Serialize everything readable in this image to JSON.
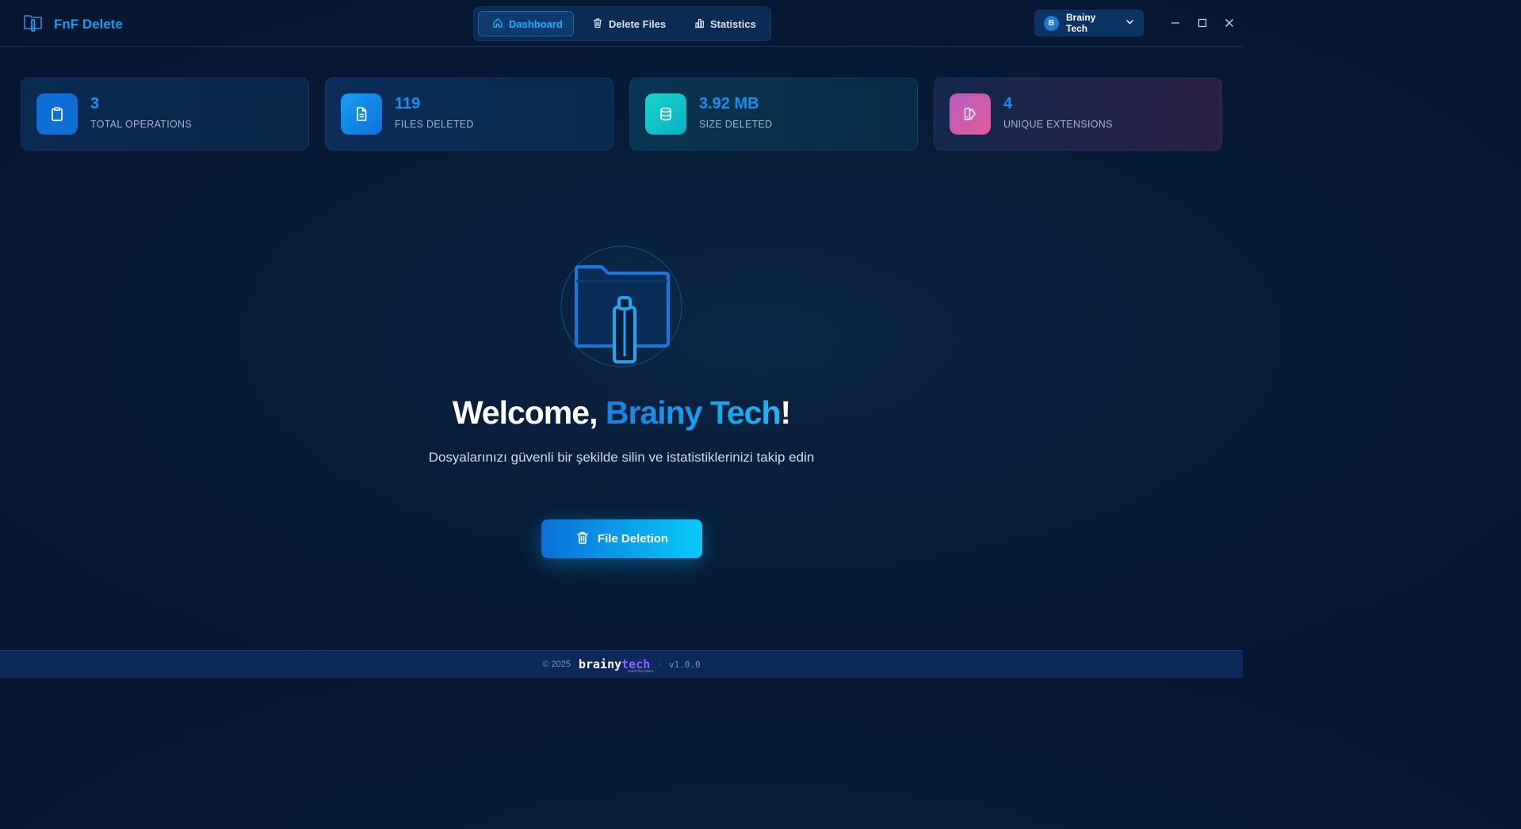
{
  "app": {
    "title": "FnF Delete"
  },
  "nav": {
    "tabs": [
      {
        "label": "Dashboard",
        "icon": "home-icon",
        "active": true
      },
      {
        "label": "Delete Files",
        "icon": "trash-icon",
        "active": false
      },
      {
        "label": "Statistics",
        "icon": "bar-chart-icon",
        "active": false
      }
    ]
  },
  "user": {
    "initial": "B",
    "name": "Brainy Tech"
  },
  "stats": [
    {
      "value": "3",
      "label": "TOTAL OPERATIONS",
      "icon": "clipboard-icon",
      "color": "#0f6fd6"
    },
    {
      "value": "119",
      "label": "FILES DELETED",
      "icon": "file-text-icon",
      "color": "#1391ec"
    },
    {
      "value": "3.92 MB",
      "label": "SIZE DELETED",
      "icon": "database-icon",
      "color": "#13c3c8"
    },
    {
      "value": "4",
      "label": "UNIQUE EXTENSIONS",
      "icon": "swatches-icon",
      "color": "#d45ba8"
    }
  ],
  "hero": {
    "welcome_prefix": "Welcome, ",
    "welcome_name": "Brainy Tech",
    "welcome_suffix": "!",
    "subtitle": "Dosyalarınızı güvenli bir şekilde silin ve istatistiklerinizi takip edin",
    "cta_label": "File Deletion"
  },
  "footer": {
    "copyright": "© 2025",
    "logo_part1": "brainy",
    "logo_part2": "tech",
    "tagline": "reach the future",
    "separator": "·",
    "version": "v1.0.0"
  },
  "colors": {
    "accent": "#1e9bf0",
    "background": "#071a33",
    "footer": "#0b2a5b"
  }
}
